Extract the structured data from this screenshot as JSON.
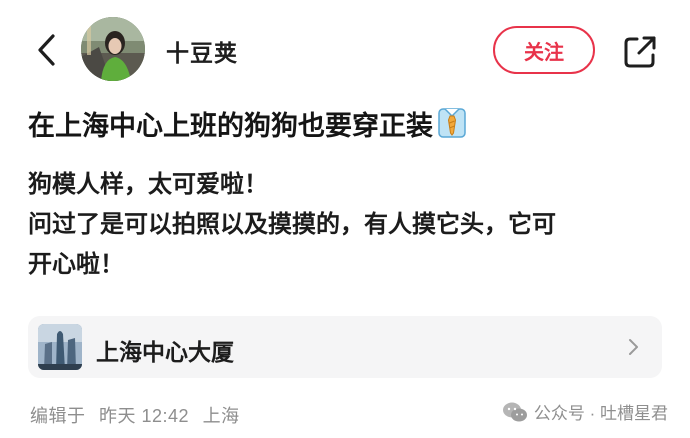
{
  "header": {
    "author_name": "十豆荚",
    "follow_label": "关注"
  },
  "post": {
    "title": "在上海中心上班的狗狗也要穿正装",
    "title_emoji_icon": "necktie-shirt-icon",
    "body_lines": [
      "狗模人样，太可爱啦！",
      "问过了是可以拍照以及摸摸的，有人摸它头，它可",
      "开心啦！"
    ]
  },
  "location": {
    "name": "上海中心大厦"
  },
  "meta": {
    "edited_prefix": "编辑于",
    "time": "昨天 12:42",
    "region": "上海"
  },
  "watermark": {
    "text": "公众号 · 吐槽星君"
  },
  "colors": {
    "accent": "#e8334a",
    "text": "#1b1b1b",
    "muted": "#8e8e8e",
    "card_bg": "#f5f5f6"
  }
}
